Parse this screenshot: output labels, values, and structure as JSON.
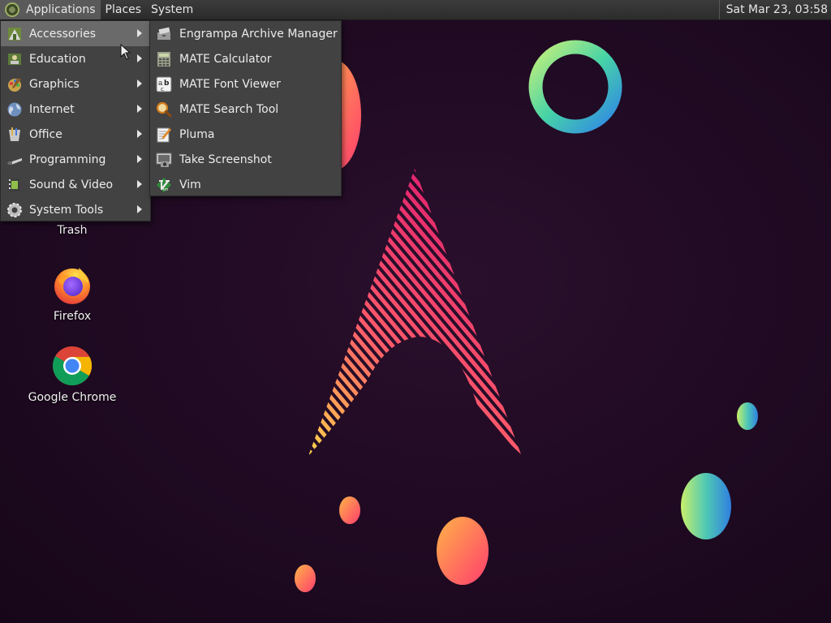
{
  "panel": {
    "menus": [
      "Applications",
      "Places",
      "System"
    ],
    "clock": "Sat Mar 23, 03:58"
  },
  "app_menu": {
    "categories": [
      {
        "label": "Accessories",
        "icon": "accessories-icon"
      },
      {
        "label": "Education",
        "icon": "education-icon"
      },
      {
        "label": "Graphics",
        "icon": "graphics-icon"
      },
      {
        "label": "Internet",
        "icon": "internet-icon"
      },
      {
        "label": "Office",
        "icon": "office-icon"
      },
      {
        "label": "Programming",
        "icon": "programming-icon"
      },
      {
        "label": "Sound & Video",
        "icon": "sound-video-icon"
      },
      {
        "label": "System Tools",
        "icon": "system-tools-icon"
      }
    ],
    "active_category": "Accessories",
    "submenu": [
      {
        "label": "Engrampa Archive Manager",
        "icon": "archive-manager-icon"
      },
      {
        "label": "MATE Calculator",
        "icon": "calculator-icon"
      },
      {
        "label": "MATE Font Viewer",
        "icon": "font-viewer-icon"
      },
      {
        "label": "MATE Search Tool",
        "icon": "search-tool-icon"
      },
      {
        "label": "Pluma",
        "icon": "text-editor-icon"
      },
      {
        "label": "Take Screenshot",
        "icon": "screenshot-icon"
      },
      {
        "label": "Vim",
        "icon": "vim-icon"
      }
    ]
  },
  "desktop": {
    "icons": [
      {
        "label": "Trash",
        "icon": "trash-icon"
      },
      {
        "label": "Firefox",
        "icon": "firefox-icon"
      },
      {
        "label": "Google Chrome",
        "icon": "chrome-icon"
      }
    ]
  },
  "colors": {
    "panel_bg": "#2f2f2f",
    "menu_bg": "#424242",
    "menu_highlight": "#6a6a6a",
    "desktop_bg": "#1f0a22"
  }
}
